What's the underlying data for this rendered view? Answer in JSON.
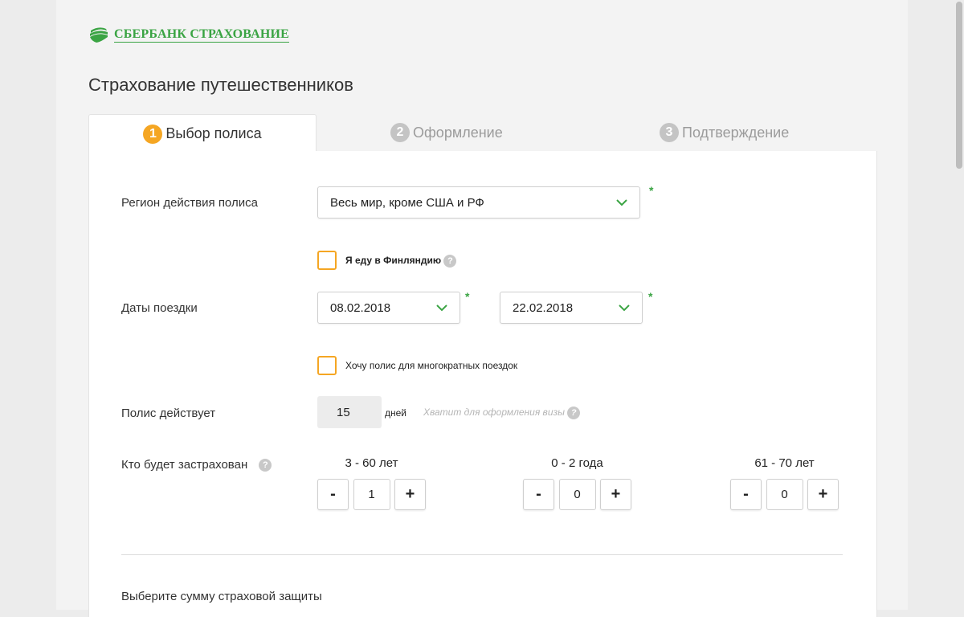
{
  "logo": {
    "text": "СБЕРБАНК СТРАХОВАНИЕ"
  },
  "page_title": "Страхование путешественников",
  "tabs": [
    {
      "num": "1",
      "label": "Выбор полиса",
      "active": true
    },
    {
      "num": "2",
      "label": "Оформление",
      "active": false
    },
    {
      "num": "3",
      "label": "Подтверждение",
      "active": false
    }
  ],
  "form": {
    "region": {
      "label": "Регион действия полиса",
      "value": "Весь мир, кроме США и РФ",
      "required": "*"
    },
    "finland": {
      "label": "Я еду в Финляндию",
      "help": "?"
    },
    "dates": {
      "label": "Даты поездки",
      "from": "08.02.2018",
      "to": "22.02.2018",
      "required": "*"
    },
    "multi_trip": {
      "label": "Хочу полис для многократных поездок"
    },
    "duration": {
      "label": "Полис действует",
      "value": "15",
      "unit": "дней",
      "hint": "Хватит для оформления визы",
      "help": "?"
    },
    "insured": {
      "label": "Кто будет застрахован",
      "help": "?",
      "groups": [
        {
          "age": "3 - 60 лет",
          "count": "1"
        },
        {
          "age": "0 - 2 года",
          "count": "0"
        },
        {
          "age": "61 - 70 лет",
          "count": "0"
        }
      ],
      "minus": "-",
      "plus": "+"
    },
    "sum_title": "Выберите сумму страховой защиты"
  },
  "colors": {
    "brand_green": "#3aa443",
    "accent_orange": "#f5a623"
  },
  "icons": {
    "logo": "sber-logo-icon",
    "dropdown": "chevron-down-icon",
    "help": "question-icon"
  }
}
